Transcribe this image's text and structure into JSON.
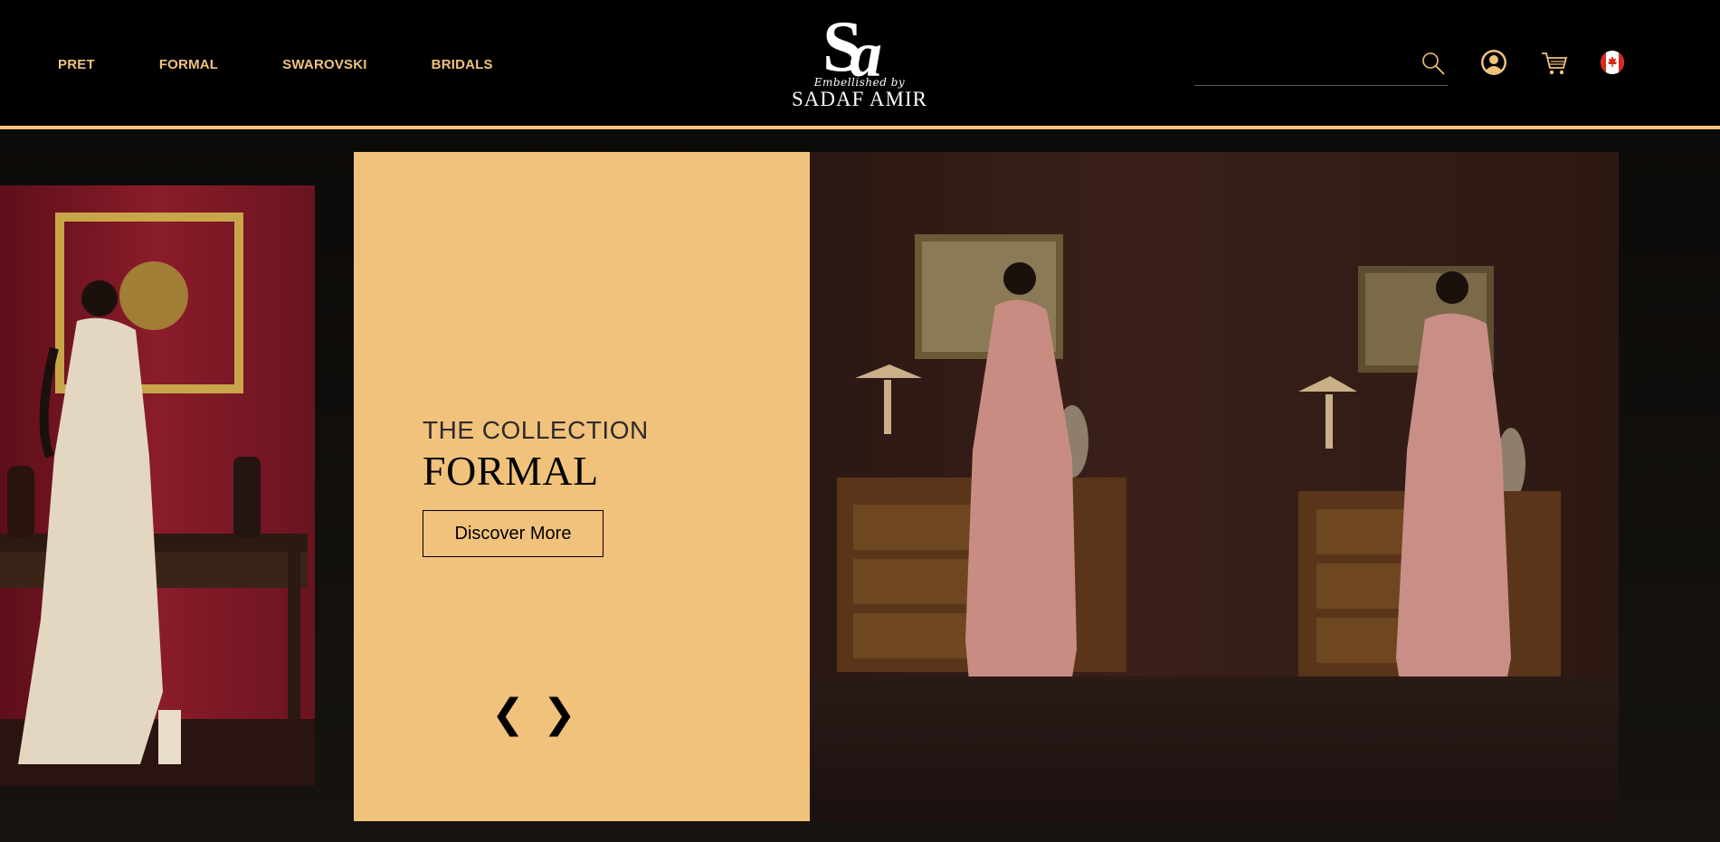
{
  "nav": {
    "items": [
      "PRET",
      "FORMAL",
      "SWAROVSKI",
      "BRIDALS"
    ]
  },
  "logo": {
    "monogram": "SA",
    "tagline": "Embellished by",
    "name": "SADAF AMIR"
  },
  "search": {
    "placeholder": ""
  },
  "icons": {
    "search": "search-icon",
    "user": "user-icon",
    "cart": "cart-icon",
    "flag": "canada-flag-icon"
  },
  "hero": {
    "title_small": "THE COLLECTION",
    "title_big": "FORMAL",
    "cta": "Discover More",
    "prev": "❮",
    "next": "❯"
  },
  "colors": {
    "accent": "#f1c27c",
    "header_bg": "#000000",
    "page_bg": "#0a0908"
  }
}
